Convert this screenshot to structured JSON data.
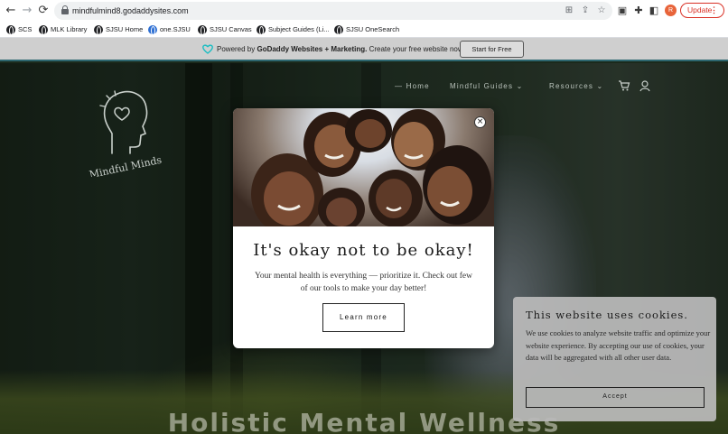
{
  "browser": {
    "url": "mindfulmind8.godaddysites.com",
    "profile_initial": "R",
    "update_label": "Update",
    "menu_icon": "kebab-menu-icon",
    "bookmarks": [
      "SCS",
      "MLK Library",
      "SJSU Home",
      "one.SJSU",
      "SJSU Canvas",
      "Subject Guides (Li...",
      "SJSU OneSearch"
    ]
  },
  "banner": {
    "powered_by": "Powered by ",
    "brand": "GoDaddy Websites + Marketing.",
    "cta_text": " Create your free website now.",
    "button_label": "Start for Free"
  },
  "site": {
    "logo_text": "Mindful Minds",
    "nav": [
      "Home",
      "Mindful Guides",
      "Resources"
    ],
    "hero_title": "Holistic Mental Wellness"
  },
  "modal": {
    "title": "It's okay not to be okay!",
    "body": "Your mental health is everything — prioritize it. Check out few of our tools to make your day better!",
    "button_label": "Learn more",
    "close_icon": "close-icon"
  },
  "cookie": {
    "title": "This website uses cookies.",
    "text": "We use cookies to analyze website traffic and optimize your website experience. By accepting our use of cookies, your data will be aggregated with all other user data.",
    "accept_label": "Accept"
  },
  "colors": {
    "update_red": "#d93025",
    "banner_accent": "#2d6770",
    "profile": "#e8643a"
  }
}
